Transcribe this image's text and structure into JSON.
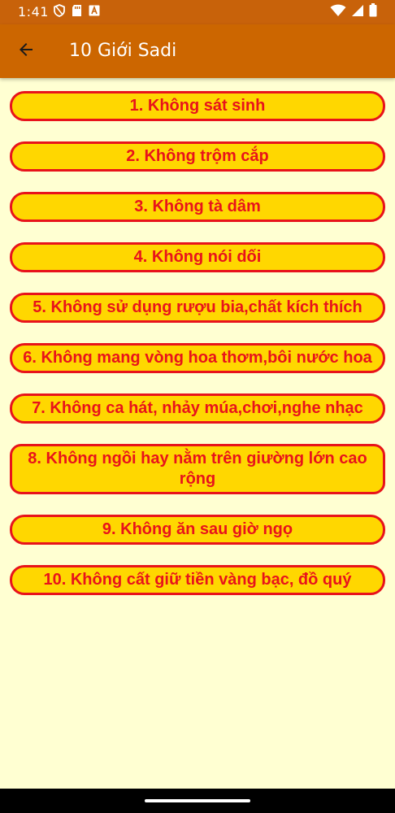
{
  "status_bar": {
    "time": "1:41",
    "icons_left": [
      "shield-icon",
      "sd-card-icon",
      "a-badge-icon"
    ],
    "icons_right": [
      "wifi-icon",
      "signal-icon",
      "battery-icon"
    ]
  },
  "app_bar": {
    "title": "10 Giới Sadi",
    "back_icon": "arrow-left-icon",
    "color": "#CC6600"
  },
  "items": [
    {
      "label": "1. Không sát sinh"
    },
    {
      "label": "2. Không trộm cắp"
    },
    {
      "label": "3. Không tà dâm"
    },
    {
      "label": "4. Không nói dối"
    },
    {
      "label": "5. Không sử dụng rượu bia,chất kích thích"
    },
    {
      "label": "6. Không mang vòng hoa thơm,bôi nước hoa"
    },
    {
      "label": "7. Không ca hát, nhảy múa,chơi,nghe nhạc"
    },
    {
      "label": "8. Không ngồi hay nằm trên giường lớn cao rộng"
    },
    {
      "label": "9. Không ăn sau giờ ngọ"
    },
    {
      "label": "10. Không cất giữ tiền vàng bạc, đồ quý"
    }
  ],
  "colors": {
    "background": "#FFFFD2",
    "button_fill": "#FFD700",
    "button_text": "#E8131B",
    "button_border": "#E8131B"
  }
}
